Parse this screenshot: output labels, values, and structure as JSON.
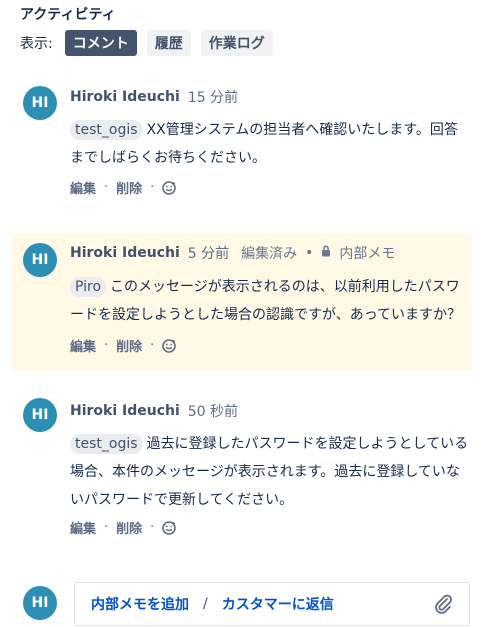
{
  "activity": {
    "title": "アクティビティ",
    "show_label": "表示:"
  },
  "filters": [
    {
      "label": "コメント",
      "active": true
    },
    {
      "label": "履歴",
      "active": false
    },
    {
      "label": "作業ログ",
      "active": false
    }
  ],
  "comments": [
    {
      "initials": "HI",
      "author": "Hiroki Ideuchi",
      "time": "15 分前",
      "mention": "test_ogis",
      "text": "XX管理システムの担当者へ確認いたします。回答までしばらくお待ちください。",
      "edit": "編集",
      "delete": "削除"
    },
    {
      "initials": "HI",
      "author": "Hiroki Ideuchi",
      "time": "5 分前",
      "edited": "編集済み",
      "internal_label": "内部メモ",
      "mention": "Piro",
      "text": "このメッセージが表示されるのは、以前利用したパスワードを設定しようとした場合の認識ですが、あっていますか？",
      "edit": "編集",
      "delete": "削除"
    },
    {
      "initials": "HI",
      "author": "Hiroki Ideuchi",
      "time": "50 秒前",
      "mention": "test_ogis",
      "text": "過去に登録したパスワードを設定しようとしている場合、本件のメッセージが表示されます。過去に登録していないパスワードで更新してください。",
      "edit": "編集",
      "delete": "削除"
    }
  ],
  "reply": {
    "initials": "HI",
    "internal_note": "内部メモを追加",
    "separator": "/",
    "reply_customer": "カスタマーに返信",
    "attach_icon": "paperclip-icon"
  },
  "colors": {
    "avatar": "#2d8fb4",
    "active_filter": "#44546f",
    "link": "#0052cc",
    "internal_bg": "#fff9e6"
  }
}
